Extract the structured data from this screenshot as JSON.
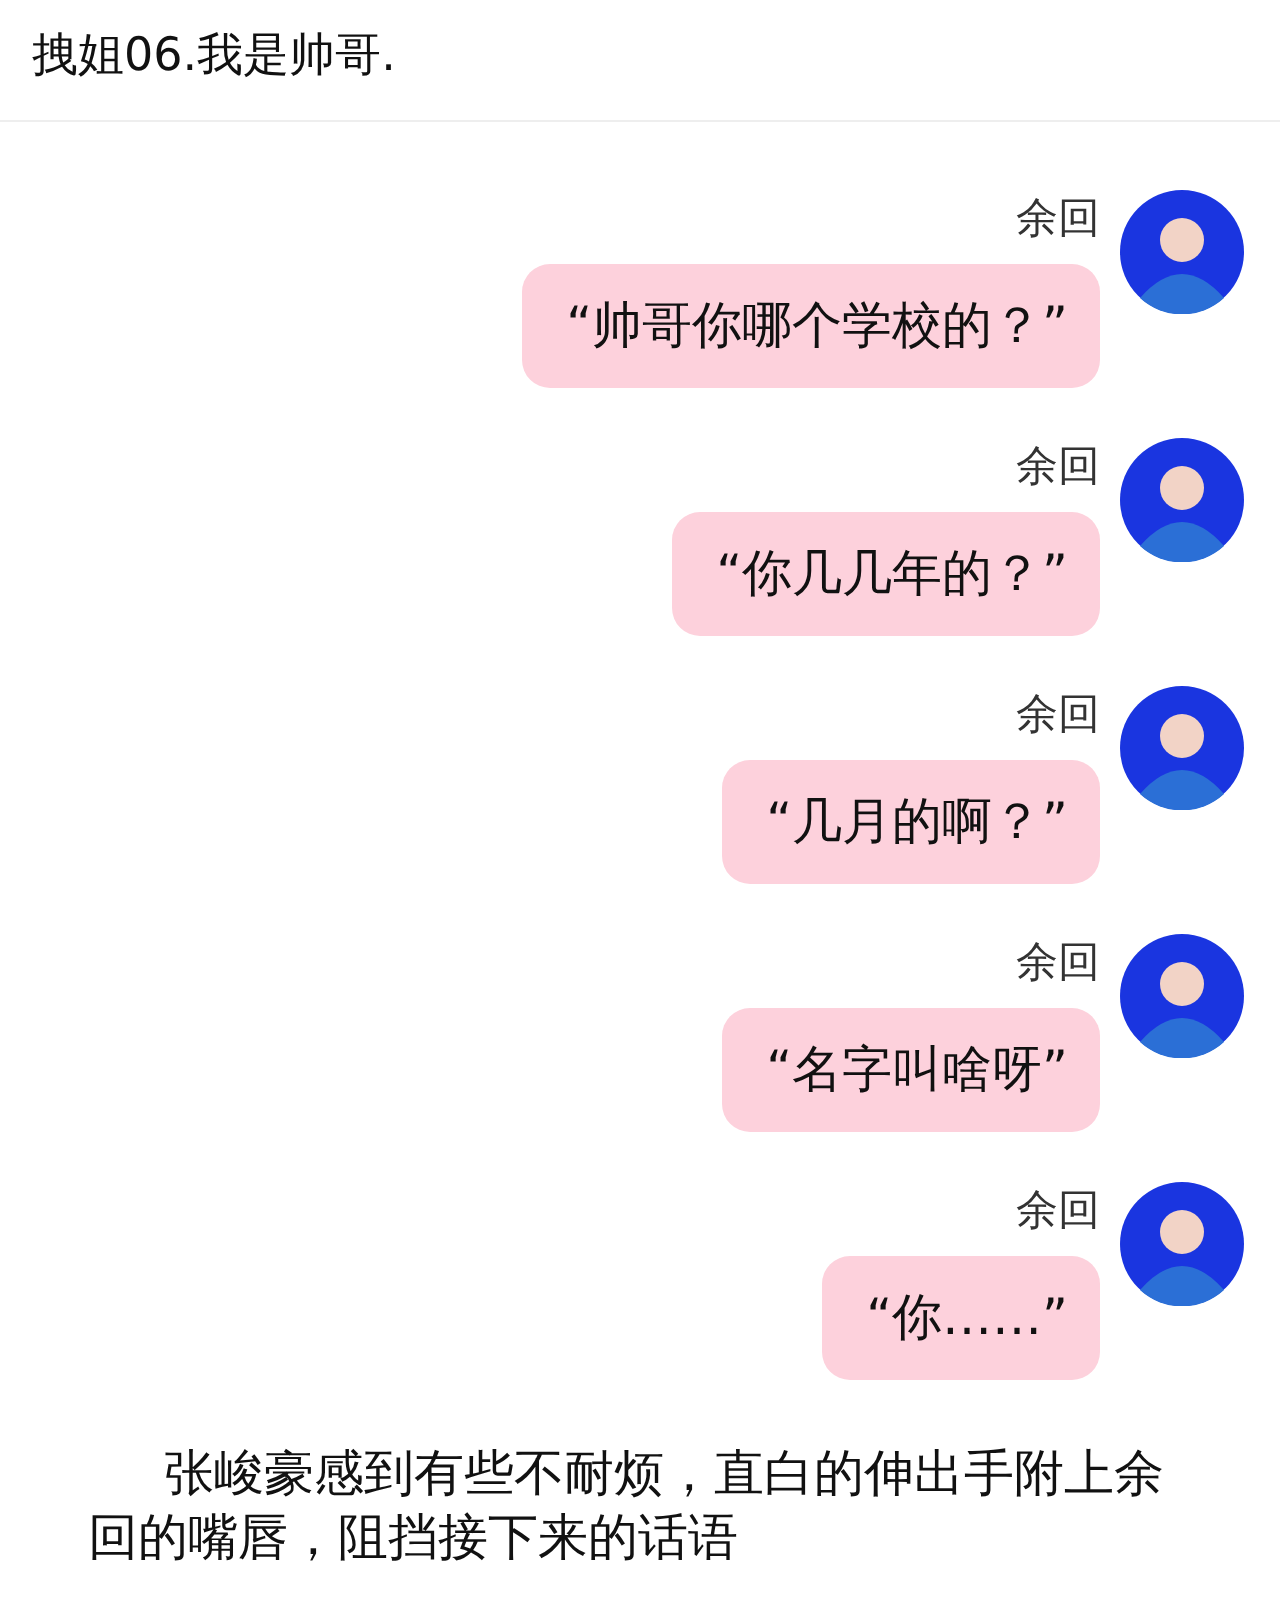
{
  "header": {
    "title": "拽姐06.我是帅哥."
  },
  "messages": [
    {
      "sender": "余回",
      "text": "“帅哥你哪个学校的？”"
    },
    {
      "sender": "余回",
      "text": "“你几几年的？”"
    },
    {
      "sender": "余回",
      "text": "“几月的啊？”"
    },
    {
      "sender": "余回",
      "text": "“名字叫啥呀”"
    },
    {
      "sender": "余回",
      "text": "“你……”"
    }
  ],
  "narration": "张峻豪感到有些不耐烦，直白的伸出手附上余回的嘴唇，阻挡接下来的话语"
}
